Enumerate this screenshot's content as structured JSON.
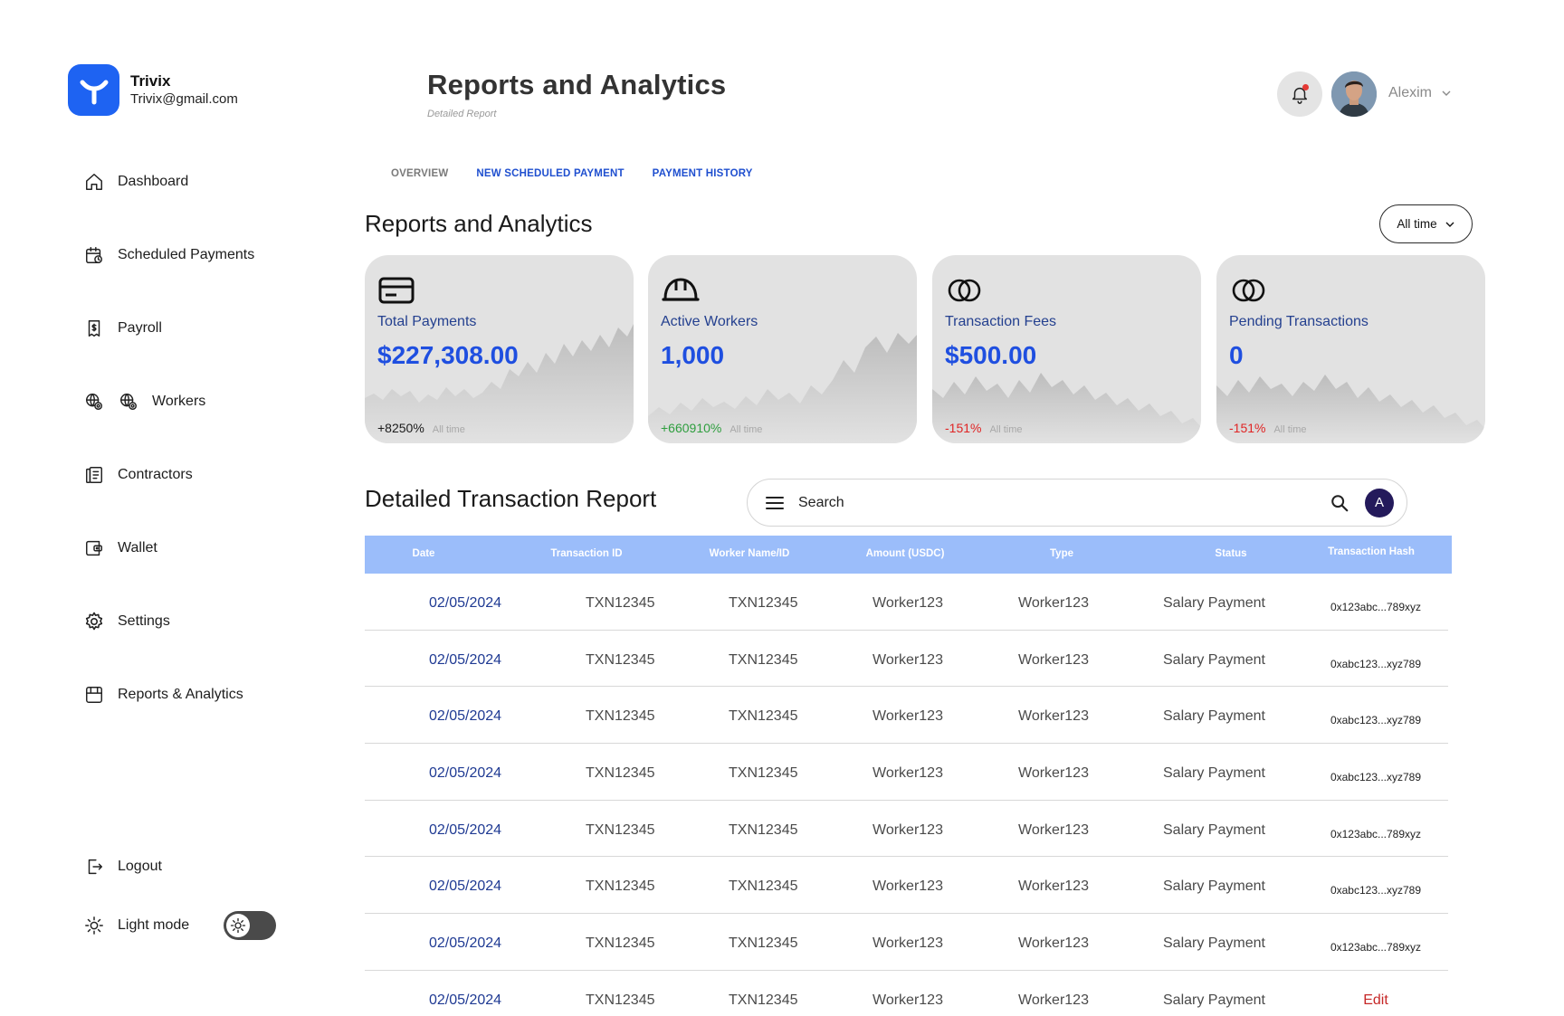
{
  "brand": {
    "name": "Trivix",
    "email": "Trivix@gmail.com"
  },
  "sidebar": {
    "items": [
      {
        "label": "Dashboard",
        "icon": "home-icon"
      },
      {
        "label": "Scheduled Payments",
        "icon": "calendar-clock-icon"
      },
      {
        "label": "Payroll",
        "icon": "receipt-icon"
      },
      {
        "label": "Workers",
        "icon": "globe-gear-icon"
      },
      {
        "label": "Contractors",
        "icon": "contract-icon"
      },
      {
        "label": "Wallet",
        "icon": "wallet-icon"
      },
      {
        "label": "Settings",
        "icon": "gear-icon"
      },
      {
        "label": "Reports & Analytics",
        "icon": "reports-icon"
      }
    ],
    "logout_label": "Logout",
    "light_mode_label": "Light mode",
    "light_mode_on": true
  },
  "header": {
    "title": "Reports and Analytics",
    "subtitle": "Detailed Report",
    "user_name": "Alexim",
    "has_notification": true
  },
  "tabs": [
    {
      "label": "OVERVIEW",
      "state": "muted"
    },
    {
      "label": "NEW SCHEDULED PAYMENT",
      "state": "active"
    },
    {
      "label": "PAYMENT HISTORY",
      "state": "active"
    }
  ],
  "overview": {
    "title": "Reports and Analytics",
    "range": "All time"
  },
  "cards": [
    {
      "icon": "credit-card-icon",
      "label": "Total Payments",
      "value": "$227,308.00",
      "change": "+8250%",
      "change_color": "#1b1b1b",
      "range": "All time"
    },
    {
      "icon": "helmet-icon",
      "label": "Active Workers",
      "value": "1,000",
      "change": "+660910%",
      "change_color": "#2e9e3e",
      "range": "All time"
    },
    {
      "icon": "rings-icon",
      "label": "Transaction Fees",
      "value": "$500.00",
      "change": "-151%",
      "change_color": "#e02424",
      "range": "All time"
    },
    {
      "icon": "rings-icon",
      "label": "Pending Transactions",
      "value": "0",
      "change": "-151%",
      "change_color": "#e02424",
      "range": "All time"
    }
  ],
  "report": {
    "title": "Detailed Transaction Report",
    "search_placeholder": "Search",
    "avatar_letter": "A"
  },
  "table": {
    "headers": [
      "Date",
      "Transaction ID",
      "Worker Name/ID",
      "Amount (USDC)",
      "Type",
      "Status",
      "Transaction Hash"
    ],
    "rows": [
      {
        "date": "02/05/2024",
        "txn": "TXN12345",
        "worker": "TXN12345",
        "amount": "Worker123",
        "type": "Worker123",
        "status": "Salary Payment",
        "hash": "0x123abc...789xyz"
      },
      {
        "date": "02/05/2024",
        "txn": "TXN12345",
        "worker": "TXN12345",
        "amount": "Worker123",
        "type": "Worker123",
        "status": "Salary Payment",
        "hash": "0xabc123...xyz789"
      },
      {
        "date": "02/05/2024",
        "txn": "TXN12345",
        "worker": "TXN12345",
        "amount": "Worker123",
        "type": "Worker123",
        "status": "Salary Payment",
        "hash": "0xabc123...xyz789"
      },
      {
        "date": "02/05/2024",
        "txn": "TXN12345",
        "worker": "TXN12345",
        "amount": "Worker123",
        "type": "Worker123",
        "status": "Salary Payment",
        "hash": "0xabc123...xyz789"
      },
      {
        "date": "02/05/2024",
        "txn": "TXN12345",
        "worker": "TXN12345",
        "amount": "Worker123",
        "type": "Worker123",
        "status": "Salary Payment",
        "hash": "0x123abc...789xyz"
      },
      {
        "date": "02/05/2024",
        "txn": "TXN12345",
        "worker": "TXN12345",
        "amount": "Worker123",
        "type": "Worker123",
        "status": "Salary Payment",
        "hash": "0xabc123...xyz789"
      },
      {
        "date": "02/05/2024",
        "txn": "TXN12345",
        "worker": "TXN12345",
        "amount": "Worker123",
        "type": "Worker123",
        "status": "Salary Payment",
        "hash": "0x123abc...789xyz"
      },
      {
        "date": "02/05/2024",
        "txn": "TXN12345",
        "worker": "TXN12345",
        "amount": "Worker123",
        "type": "Worker123",
        "status": "Salary Payment",
        "hash": "Edit"
      }
    ]
  },
  "colors": {
    "brand": "#1e63f2",
    "tab_active": "#1f4fcf",
    "table_header": "#9bbdfa",
    "card_bg": "#e2e2e2",
    "positive": "#2e9e3e",
    "negative": "#e02424"
  }
}
